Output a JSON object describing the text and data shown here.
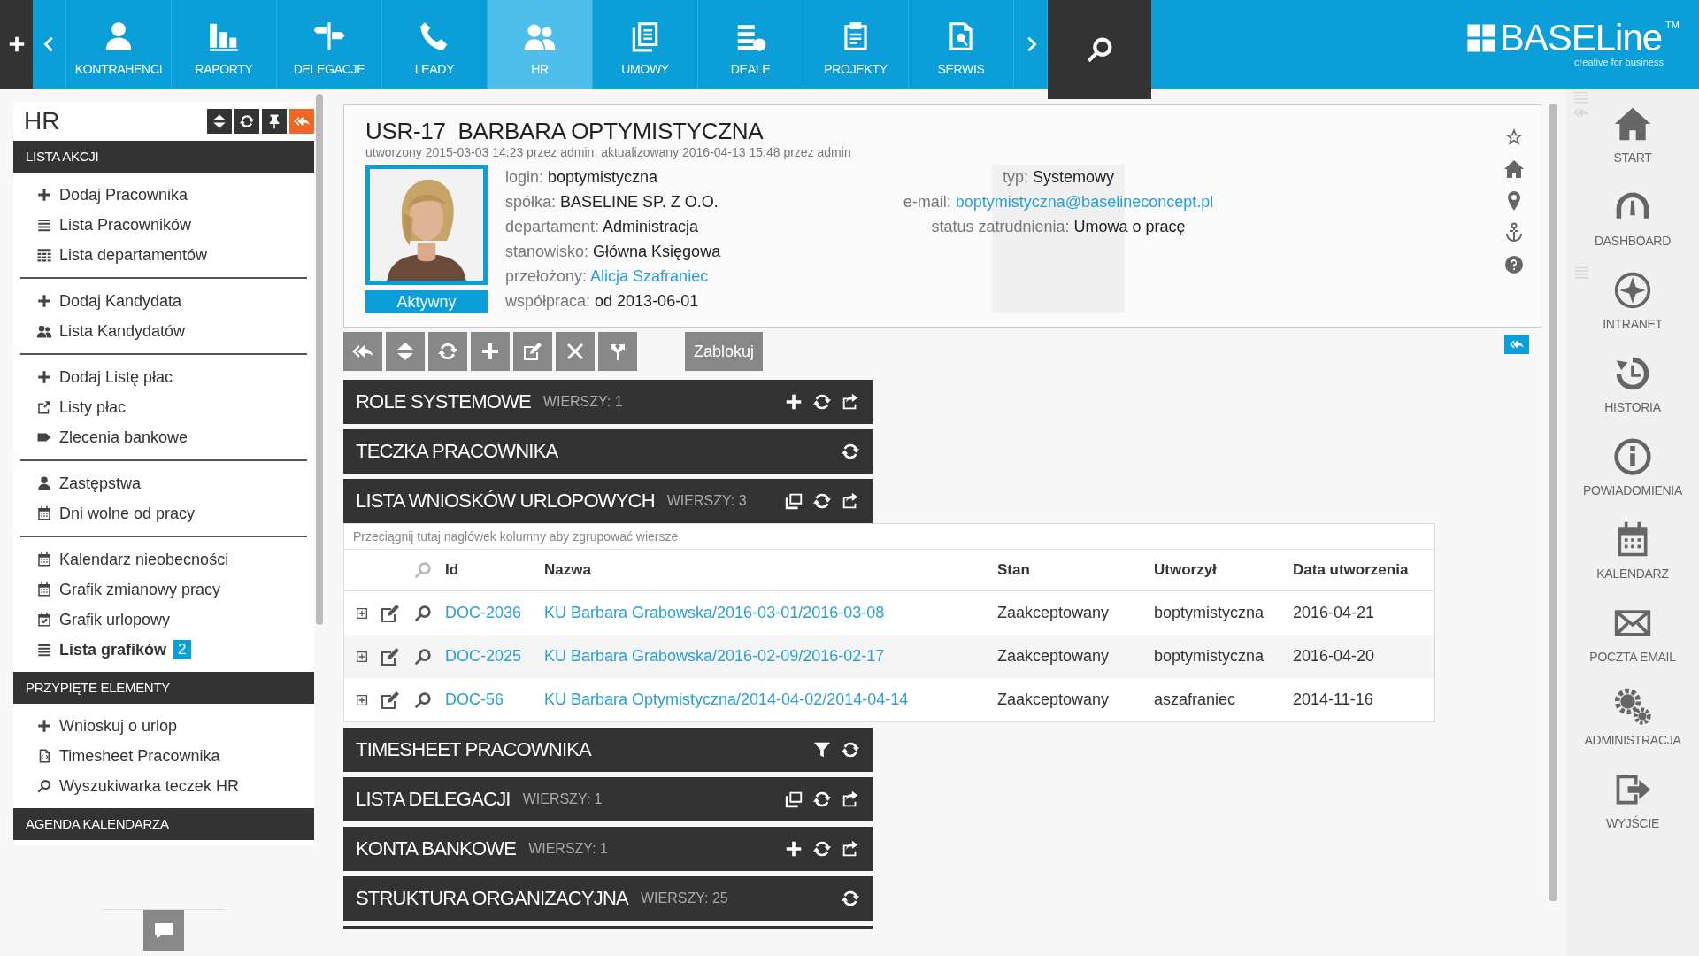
{
  "top_nav": {
    "items": [
      {
        "label": "KONTRAHENCI",
        "selected": false
      },
      {
        "label": "RAPORTY",
        "selected": false
      },
      {
        "label": "DELEGACJE",
        "selected": false
      },
      {
        "label": "LEADY",
        "selected": false
      },
      {
        "label": "HR",
        "selected": true
      },
      {
        "label": "UMOWY",
        "selected": false
      },
      {
        "label": "DEALE",
        "selected": false
      },
      {
        "label": "PROJEKTY",
        "selected": false
      },
      {
        "label": "SERWIS",
        "selected": false
      }
    ]
  },
  "logo": {
    "name": "BASELine",
    "trademark": "TM",
    "tagline": "creative for business"
  },
  "left_panel": {
    "title": "HR",
    "sections": [
      {
        "title": "LISTA AKCJI",
        "groups": [
          [
            {
              "label": "Dodaj Pracownika",
              "selected": false
            },
            {
              "label": "Lista Pracowników",
              "selected": false
            },
            {
              "label": "Lista departamentów",
              "selected": false
            }
          ],
          [
            {
              "label": "Dodaj Kandydata",
              "selected": false
            },
            {
              "label": "Lista Kandydatów",
              "selected": false
            }
          ],
          [
            {
              "label": "Dodaj Listę płac",
              "selected": false
            },
            {
              "label": "Listy płac",
              "selected": false
            },
            {
              "label": "Zlecenia bankowe",
              "selected": false
            }
          ],
          [
            {
              "label": "Zastępstwa",
              "selected": false
            },
            {
              "label": "Dni wolne od pracy",
              "selected": false
            }
          ],
          [
            {
              "label": "Kalendarz nieobecności",
              "selected": false
            },
            {
              "label": "Grafik zmianowy pracy",
              "selected": false
            },
            {
              "label": "Grafik urlopowy",
              "selected": false
            },
            {
              "label": "Lista grafików",
              "selected": true,
              "badge": "2"
            }
          ]
        ]
      },
      {
        "title": "PRZYPIĘTE ELEMENTY",
        "groups": [
          [
            {
              "label": "Wnioskuj o urlop",
              "selected": false
            },
            {
              "label": "Timesheet Pracownika",
              "selected": false
            },
            {
              "label": "Wyszukiwarka teczek HR",
              "selected": false
            }
          ]
        ]
      },
      {
        "title": "AGENDA KALENDARZA"
      }
    ]
  },
  "profile": {
    "id": "USR-17",
    "name": "BARBARA OPTYMISTYCZNA",
    "meta": "utworzony 2015-03-03 14:23 przez admin, aktualizowany 2016-04-13 15:48 przez admin",
    "status": "Aktywny",
    "fields_left": [
      {
        "label": "login:",
        "value": "boptymistyczna",
        "kind": "text"
      },
      {
        "label": "spółka:",
        "value": "BASELINE SP. Z O.O.",
        "kind": "text"
      },
      {
        "label": "departament:",
        "value": "Administracja",
        "kind": "text"
      },
      {
        "label": "stanowisko:",
        "value": "Główna Księgowa",
        "kind": "text"
      },
      {
        "label": "przełożony:",
        "value": "Alicja Szafraniec",
        "kind": "link"
      },
      {
        "label": "współpraca:",
        "value": "od 2013-06-01",
        "kind": "text"
      }
    ],
    "fields_right": [
      {
        "label": "typ:",
        "value": "Systemowy",
        "kind": "text"
      },
      {
        "label": "e-mail:",
        "value": "boptymistyczna@baselineconcept.pl",
        "kind": "link"
      },
      {
        "label": "status zatrudnienia:",
        "value": "Umowa o pracę",
        "kind": "text"
      }
    ]
  },
  "toolbar": {
    "text_button": "Zablokuj"
  },
  "sections": [
    {
      "title": "ROLE SYSTEMOWE",
      "count": "WIERSZY: 1"
    },
    {
      "title": "TECZKA PRACOWNIKA"
    },
    {
      "title": "LISTA WNIOSKÓW URLOPOWYCH",
      "count": "WIERSZY: 3",
      "table": {
        "group_hint": "Przeciągnij tutaj nagłówek kolumny aby zgrupować wiersze",
        "columns": [
          "Id",
          "Nazwa",
          "Stan",
          "Utworzył",
          "Data utworzenia"
        ],
        "rows": [
          {
            "id": "DOC-2036",
            "name": "KU Barbara Grabowska/2016-03-01/2016-03-08",
            "status": "Zaakceptowany",
            "created_by": "boptymistyczna",
            "date": "2016-04-21"
          },
          {
            "id": "DOC-2025",
            "name": "KU Barbara Grabowska/2016-02-09/2016-02-17",
            "status": "Zaakceptowany",
            "created_by": "boptymistyczna",
            "date": "2016-04-20"
          },
          {
            "id": "DOC-56",
            "name": "KU Barbara Optymistyczna/2014-04-02/2014-04-14",
            "status": "Zaakceptowany",
            "created_by": "aszafraniec",
            "date": "2014-11-16"
          }
        ]
      }
    },
    {
      "title": "TIMESHEET PRACOWNIKA"
    },
    {
      "title": "LISTA DELEGACJI",
      "count": "WIERSZY: 1"
    },
    {
      "title": "KONTA BANKOWE",
      "count": "WIERSZY: 1"
    },
    {
      "title": "STRUKTURA ORGANIZACYJNA",
      "count": "WIERSZY: 25"
    }
  ],
  "right_sidebar": {
    "items": [
      {
        "label": "START"
      },
      {
        "label": "DASHBOARD"
      },
      {
        "label": "INTRANET"
      },
      {
        "label": "HISTORIA"
      },
      {
        "label": "POWIADOMIENIA"
      },
      {
        "label": "KALENDARZ"
      },
      {
        "label": "POCZTA EMAIL"
      },
      {
        "label": "ADMINISTRACJA"
      },
      {
        "label": "WYJŚCIE"
      }
    ]
  }
}
